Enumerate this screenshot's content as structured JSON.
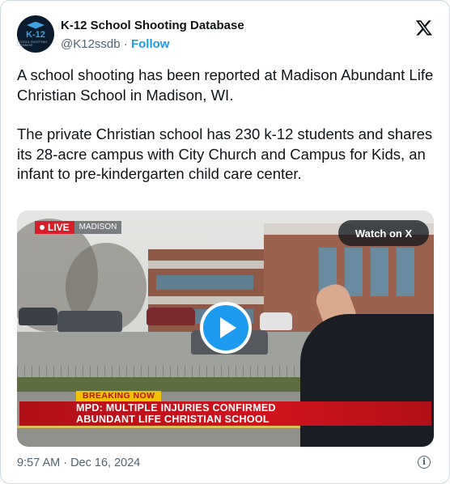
{
  "header": {
    "display_name": "K-12 School Shooting Database",
    "handle": "@K12ssdb",
    "separator": " · ",
    "follow_label": "Follow"
  },
  "avatar": {
    "logo_text": "K-12",
    "logo_subtext": "SCHOOL SHOOTING DATABASE",
    "icon": "graduation-cap-icon"
  },
  "tweet": {
    "paragraphs": [
      "A school shooting has been reported at Madison Abundant Life Christian School in Madison, WI.",
      "The private Christian school has 230 k-12 students and shares its 28-acre campus with City Church and Campus for Kids, an infant to pre-kindergarten child care center."
    ]
  },
  "media": {
    "live_label": "LIVE",
    "location_label": "MADISON",
    "watch_label": "Watch on X",
    "play_icon": "play-icon",
    "breaking_label": "BREAKING NOW",
    "headline_line1": "MPD: MULTIPLE INJURIES CONFIRMED",
    "headline_line2": "ABUNDANT LIFE CHRISTIAN SCHOOL"
  },
  "footer": {
    "timestamp": "9:57 AM · Dec 16, 2024",
    "info_icon": "info-icon"
  },
  "colors": {
    "accent": "#1d9bf0",
    "text_primary": "#0f1419",
    "text_secondary": "#536471",
    "breaking_red": "#d0141d",
    "breaking_yellow": "#f2c200"
  }
}
